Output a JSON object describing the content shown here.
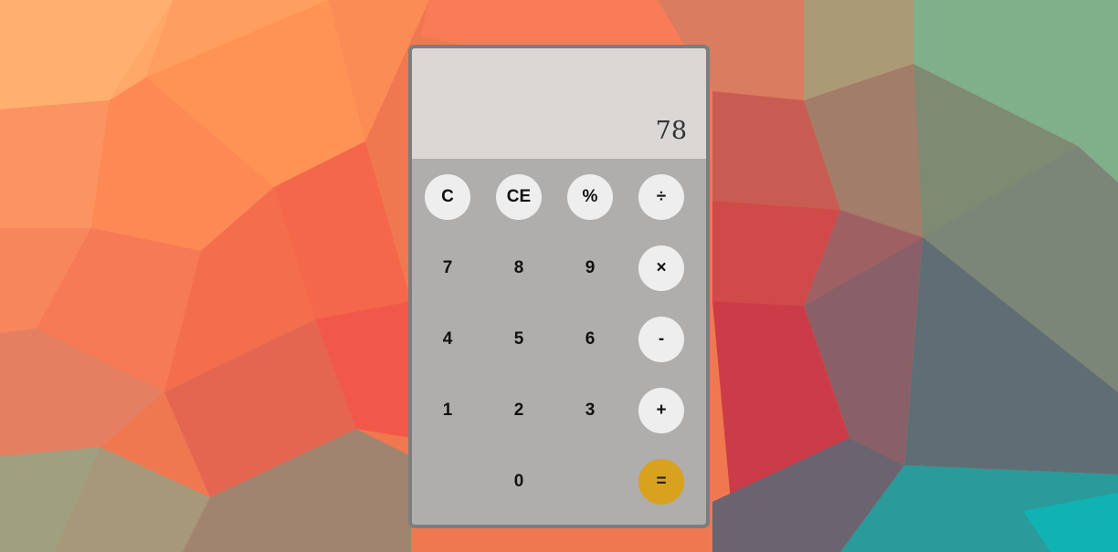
{
  "calculator": {
    "display": "78",
    "keys": {
      "clear": "C",
      "clear_entry": "CE",
      "percent": "%",
      "divide": "÷",
      "seven": "7",
      "eight": "8",
      "nine": "9",
      "multiply": "×",
      "four": "4",
      "five": "5",
      "six": "6",
      "subtract": "-",
      "one": "1",
      "two": "2",
      "three": "3",
      "add": "+",
      "zero": "0",
      "equals": "="
    }
  },
  "colors": {
    "display_bg": "#dbd7d5",
    "keypad_bg": "#afaeac",
    "operator_key_bg": "#efeeee",
    "equals_key_bg": "#d9a21e",
    "frame": "#7d7d7d"
  }
}
